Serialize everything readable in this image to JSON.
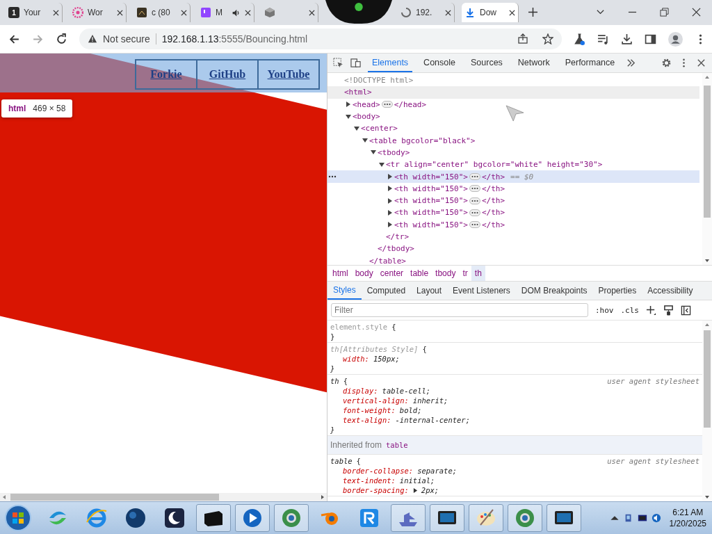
{
  "browser": {
    "tabs": [
      {
        "title": "Your",
        "kind": "numbered",
        "badge": "1",
        "audio": false,
        "selected": false
      },
      {
        "title": "Wor",
        "kind": "flower",
        "audio": false,
        "selected": false
      },
      {
        "title": "c (80",
        "kind": "dark-square",
        "audio": false,
        "selected": false
      },
      {
        "title": "M",
        "kind": "purple-square",
        "audio": true,
        "selected": false
      },
      {
        "kind": "cube",
        "audio": false,
        "selected": false
      },
      {
        "title": "192.",
        "kind": "spinner",
        "audio": false,
        "selected": false
      },
      {
        "title": "Dow",
        "kind": "download",
        "audio": false,
        "selected": true
      }
    ],
    "security": "Not secure",
    "url_host": "192.168.1.13",
    "url_path": ":5555/Bouncing.html"
  },
  "page": {
    "links": [
      "Forkie",
      "GitHub",
      "YouTube"
    ],
    "tooltip": {
      "tag": "html",
      "size": "469 × 58"
    }
  },
  "devtools": {
    "tabs": [
      {
        "label": "Elements",
        "selected": true
      },
      {
        "label": "Console",
        "selected": false
      },
      {
        "label": "Sources",
        "selected": false
      },
      {
        "label": "Network",
        "selected": false
      },
      {
        "label": "Performance",
        "selected": false
      }
    ],
    "dom": [
      {
        "text": "<!DOCTYPE html>",
        "kind": "doctype",
        "selected": false,
        "hovered": false
      },
      {
        "text": "<html>",
        "kind": "element",
        "selected": false,
        "hovered": true,
        "children": [
          {
            "text": "<head>",
            "kind": "element",
            "expanded": false,
            "end": "</head>",
            "selected": false,
            "hovered": false
          },
          {
            "text": "<body>",
            "kind": "element",
            "expanded": true,
            "selected": false,
            "hovered": false,
            "children": [
              {
                "text": "<center>",
                "kind": "element",
                "expanded": true,
                "selected": false,
                "hovered": false,
                "children": [
                  {
                    "text": "<table bgcolor=\"black\">",
                    "kind": "element",
                    "expanded": true,
                    "closing": "</table>",
                    "selected": false,
                    "hovered": false,
                    "children": [
                      {
                        "text": "<tbody>",
                        "kind": "element",
                        "expanded": true,
                        "closing": "</tbody>",
                        "selected": false,
                        "hovered": false,
                        "children": [
                          {
                            "text": "<tr align=\"center\" bgcolor=\"white\" height=\"30\">",
                            "kind": "element",
                            "expanded": true,
                            "closing": "</tr>",
                            "selected": false,
                            "hovered": false,
                            "children": [
                              {
                                "text": "<th width=\"150\">",
                                "kind": "element",
                                "expanded": false,
                                "end": "</th>",
                                "suffix": "== $0",
                                "selected": true,
                                "hovered": false
                              },
                              {
                                "text": "<th width=\"150\">",
                                "kind": "element",
                                "expanded": false,
                                "end": "</th>",
                                "selected": false,
                                "hovered": false
                              },
                              {
                                "text": "<th width=\"150\">",
                                "kind": "element",
                                "expanded": false,
                                "end": "</th>",
                                "selected": false,
                                "hovered": false
                              },
                              {
                                "text": "<th width=\"150\">",
                                "kind": "element",
                                "expanded": false,
                                "end": "</th>",
                                "selected": false,
                                "hovered": false
                              },
                              {
                                "text": "<th width=\"150\">",
                                "kind": "element",
                                "expanded": false,
                                "end": "</th>",
                                "selected": false,
                                "hovered": false
                              }
                            ]
                          }
                        ]
                      }
                    ]
                  }
                ]
              }
            ]
          }
        ]
      }
    ],
    "breadcrumbs": [
      {
        "label": "html",
        "selected": false
      },
      {
        "label": "body",
        "selected": false
      },
      {
        "label": "center",
        "selected": false
      },
      {
        "label": "table",
        "selected": false
      },
      {
        "label": "tbody",
        "selected": false
      },
      {
        "label": "tr",
        "selected": false
      },
      {
        "label": "th",
        "selected": true
      }
    ],
    "pane_tabs": [
      {
        "label": "Styles",
        "selected": true
      },
      {
        "label": "Computed",
        "selected": false
      },
      {
        "label": "Layout",
        "selected": false
      },
      {
        "label": "Event Listeners",
        "selected": false
      },
      {
        "label": "DOM Breakpoints",
        "selected": false
      },
      {
        "label": "Properties",
        "selected": false
      },
      {
        "label": "Accessibility",
        "selected": false
      }
    ],
    "filter": {
      "placeholder": "Filter"
    },
    "hov": ":hov",
    "cls": ".cls",
    "rules": [
      {
        "kind": "rule",
        "selector": "element.style",
        "muted": true,
        "italic": false,
        "open": "{",
        "close": "}"
      },
      {
        "kind": "rule",
        "selector": "th[Attributes Style]",
        "muted": true,
        "italic": true,
        "open": "{",
        "close": "}",
        "properties": [
          {
            "name": "width:",
            "value": "150px;",
            "expandable": false
          }
        ]
      },
      {
        "kind": "rule",
        "selector": "th",
        "muted": false,
        "italic": true,
        "open": "{",
        "close": "}",
        "source": "user agent stylesheet",
        "properties": [
          {
            "name": "display:",
            "value": "table-cell;",
            "expandable": false
          },
          {
            "name": "vertical-align:",
            "value": "inherit;",
            "expandable": false
          },
          {
            "name": "font-weight:",
            "value": "bold;",
            "expandable": false
          },
          {
            "name": "text-align:",
            "value": "-internal-center;",
            "expandable": false
          }
        ]
      },
      {
        "kind": "inherited",
        "label": "Inherited from",
        "element": "table"
      },
      {
        "kind": "rule",
        "selector": "table",
        "muted": false,
        "italic": true,
        "open": "{",
        "source": "user agent stylesheet",
        "properties": [
          {
            "name": "border-collapse:",
            "value": "separate;",
            "expandable": false
          },
          {
            "name": "text-indent:",
            "value": "initial;",
            "expandable": false
          },
          {
            "name": "border-spacing:",
            "value": "2px;",
            "expandable": true
          }
        ]
      }
    ]
  },
  "taskbar": {
    "apps": [
      {
        "kind": "swirl",
        "open": false
      },
      {
        "kind": "e-logo",
        "open": false
      },
      {
        "kind": "globe",
        "open": false
      },
      {
        "kind": "moon",
        "open": false
      },
      {
        "kind": "box",
        "open": true
      },
      {
        "kind": "play",
        "open": true
      },
      {
        "kind": "orb",
        "open": true
      },
      {
        "kind": "blender",
        "open": false
      },
      {
        "kind": "r-tile",
        "open": false
      },
      {
        "kind": "ship",
        "open": true
      },
      {
        "kind": "monitor",
        "open": true
      },
      {
        "kind": "palette",
        "open": true
      },
      {
        "kind": "orb",
        "open": true
      },
      {
        "kind": "monitor",
        "open": true
      }
    ],
    "time": "6:21 AM",
    "date": "1/20/2025"
  }
}
